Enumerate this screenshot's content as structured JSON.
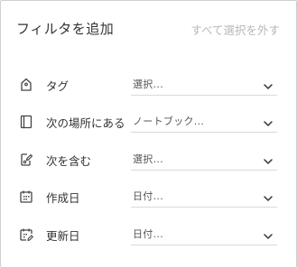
{
  "header": {
    "title": "フィルタを追加",
    "clear_label": "すべて選択を外す"
  },
  "filters": [
    {
      "label": "タグ",
      "icon": "tag-icon",
      "value": "選択..."
    },
    {
      "label": "次の場所にある",
      "icon": "notebook-icon",
      "value": "ノートブック..."
    },
    {
      "label": "次を含む",
      "icon": "contains-icon",
      "value": "選択..."
    },
    {
      "label": "作成日",
      "icon": "calendar-icon",
      "value": "日付..."
    },
    {
      "label": "更新日",
      "icon": "calendar-edit-icon",
      "value": "日付..."
    }
  ],
  "colors": {
    "text": "#333333",
    "muted": "#b8b8b8",
    "divider": "#d9d9d9",
    "border": "#cfcfcf"
  }
}
